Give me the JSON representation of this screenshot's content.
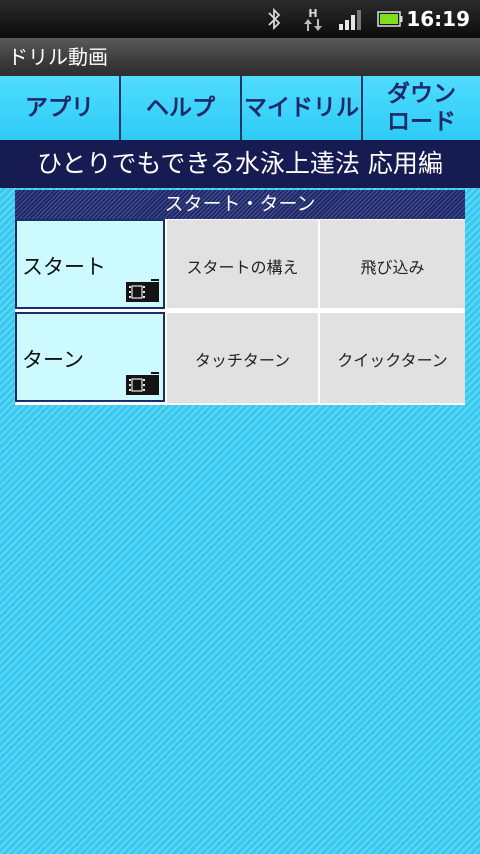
{
  "status_bar": {
    "time": "16:19",
    "network_type": "H",
    "icons": [
      "bluetooth-icon",
      "data-arrows-icon",
      "signal-icon",
      "battery-icon"
    ]
  },
  "app": {
    "title": "ドリル動画"
  },
  "tabs": [
    {
      "label": "アプリ"
    },
    {
      "label": "ヘルプ"
    },
    {
      "label": "マイドリル"
    },
    {
      "label_line1": "ダウン",
      "label_line2": "ロード"
    }
  ],
  "heading": "ひとりでもできる水泳上達法 応用編",
  "section": {
    "title": "スタート・ターン",
    "rows": [
      {
        "label": "スタート",
        "icon": "film-icon",
        "items": [
          "スタートの構え",
          "飛び込み"
        ]
      },
      {
        "label": "ターン",
        "icon": "film-icon",
        "items": [
          "タッチターン",
          "クイックターン"
        ]
      }
    ]
  },
  "colors": {
    "background": "#36c8ee",
    "tab_fill": "#3fd4fb",
    "tab_text": "#1e2a68",
    "heading_bg": "#161b52",
    "row_label_bg": "#ccfaff",
    "cell_bg": "#e1e1e1"
  }
}
